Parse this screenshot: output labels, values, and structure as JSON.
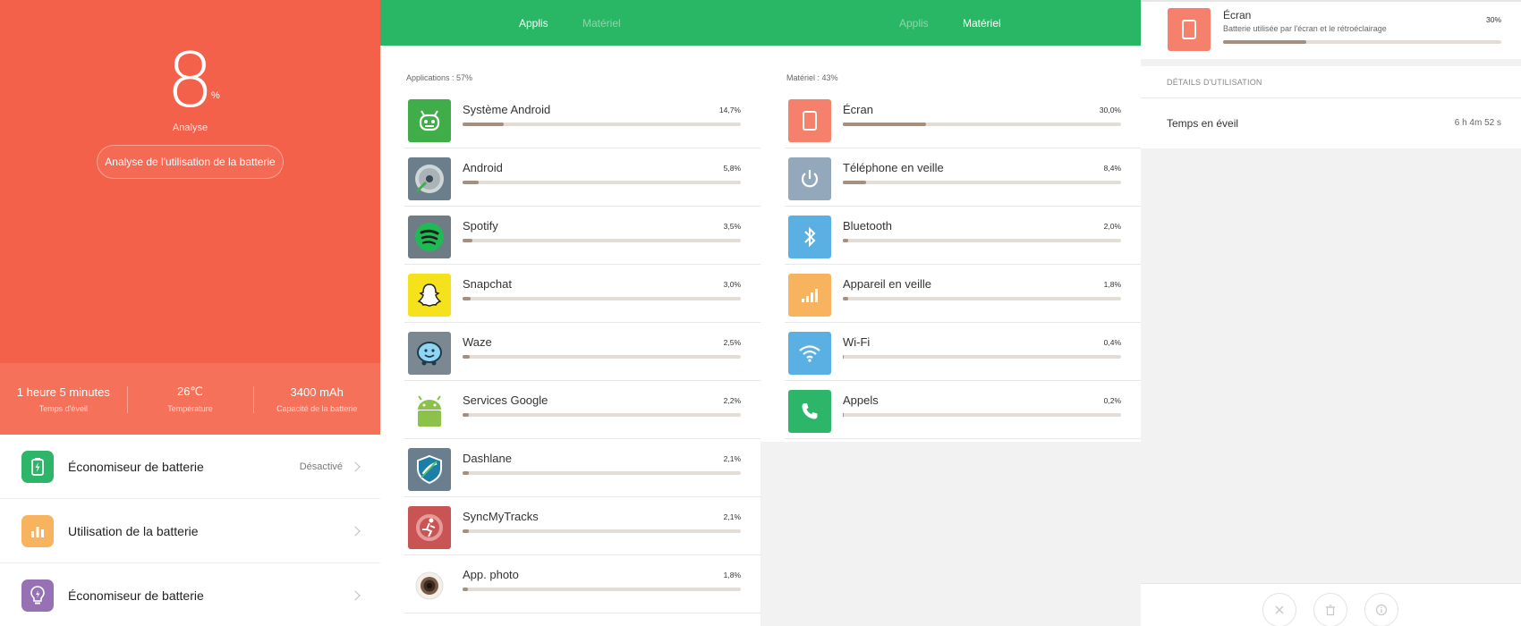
{
  "battery": {
    "percent": "8",
    "percent_sign": "%",
    "status_label": "Analyse",
    "analyse_button": "Analyse de l'utilisation de la batterie",
    "stats": [
      {
        "value": "1 heure 5 minutes",
        "label": "Temps d'éveil"
      },
      {
        "value": "26℃",
        "label": "Température"
      },
      {
        "value": "3400 mAh",
        "label": "Capacité de la batterie"
      }
    ],
    "menu": [
      {
        "label": "Économiseur de batterie",
        "value": "Désactivé",
        "icon": "battery-saver-icon",
        "color": "#2db56a"
      },
      {
        "label": "Utilisation de la batterie",
        "value": "",
        "icon": "bar-chart-icon",
        "color": "#f8b35e"
      },
      {
        "label": "Économiseur de batterie",
        "value": "",
        "icon": "lightbulb-icon",
        "color": "#9672b5"
      }
    ]
  },
  "apps_panel": {
    "tabs": [
      "Applis",
      "Matériel"
    ],
    "active_tab": "Applis",
    "section_label": "Applications : 57%",
    "items": [
      {
        "name": "Système Android",
        "pct": "14,7%",
        "value": 14.7,
        "icon": "android-robot-icon",
        "color": "#3fae49"
      },
      {
        "name": "Android",
        "pct": "5,8%",
        "value": 5.8,
        "icon": "android-disc-icon",
        "color": "#6a7e8c"
      },
      {
        "name": "Spotify",
        "pct": "3,5%",
        "value": 3.5,
        "icon": "spotify-icon",
        "color": "#6f7c86"
      },
      {
        "name": "Snapchat",
        "pct": "3,0%",
        "value": 3.0,
        "icon": "snapchat-ghost-icon",
        "color": "#f6e21c"
      },
      {
        "name": "Waze",
        "pct": "2,5%",
        "value": 2.5,
        "icon": "waze-icon",
        "color": "#7b8891"
      },
      {
        "name": "Services Google",
        "pct": "2,2%",
        "value": 2.2,
        "icon": "android-green-icon",
        "color": "#ffffff"
      },
      {
        "name": "Dashlane",
        "pct": "2,1%",
        "value": 2.1,
        "icon": "dashlane-icon",
        "color": "#6b7e8d"
      },
      {
        "name": "SyncMyTracks",
        "pct": "2,1%",
        "value": 2.1,
        "icon": "sync-runner-icon",
        "color": "#c95454"
      },
      {
        "name": "App. photo",
        "pct": "1,8%",
        "value": 1.8,
        "icon": "camera-lens-icon",
        "color": "#ffffff"
      }
    ]
  },
  "hardware_panel": {
    "tabs": [
      "Applis",
      "Matériel"
    ],
    "active_tab": "Matériel",
    "section_label": "Matériel : 43%",
    "items": [
      {
        "name": "Écran",
        "pct": "30,0%",
        "value": 30.0,
        "icon": "screen-icon",
        "color": "#f5806b"
      },
      {
        "name": "Téléphone en veille",
        "pct": "8,4%",
        "value": 8.4,
        "icon": "power-icon",
        "color": "#93a8bb"
      },
      {
        "name": "Bluetooth",
        "pct": "2,0%",
        "value": 2.0,
        "icon": "bluetooth-icon",
        "color": "#5bb0e3"
      },
      {
        "name": "Appareil en veille",
        "pct": "1,8%",
        "value": 1.8,
        "icon": "signal-icon",
        "color": "#f8b35e"
      },
      {
        "name": "Wi-Fi",
        "pct": "0,4%",
        "value": 0.4,
        "icon": "wifi-icon",
        "color": "#5bb0e3"
      },
      {
        "name": "Appels",
        "pct": "0,2%",
        "value": 0.2,
        "icon": "phone-icon",
        "color": "#2db56a"
      }
    ]
  },
  "detail_panel": {
    "title": "Écran",
    "subtitle": "Batterie utilisée par l'écran et le rétroéclairage",
    "pct": "30%",
    "value": 30,
    "details_header": "DÉTAILS D'UTILISATION",
    "row_label": "Temps en éveil",
    "row_value": "6 h 4m 52 s"
  },
  "colors": {
    "accent_orange": "#f4614a",
    "accent_green": "#2ab765",
    "bar_fill": "#a58f7f",
    "bar_track": "#e3ddd6"
  }
}
